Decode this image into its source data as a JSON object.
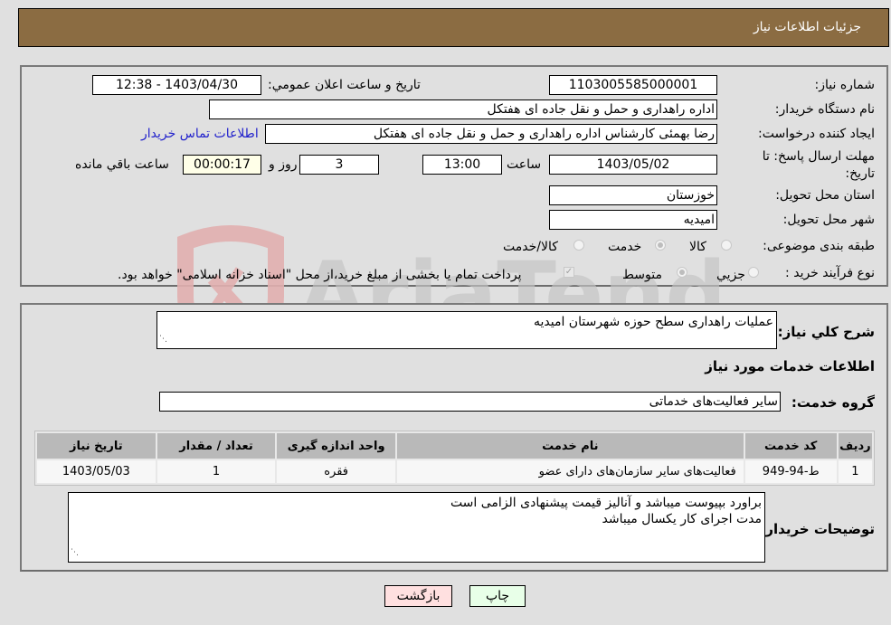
{
  "header": {
    "title": "جزئیات اطلاعات نیاز"
  },
  "form": {
    "need_number": {
      "label": "شماره نیاز:",
      "value": "1103005585000001"
    },
    "announce_datetime": {
      "label": "تاریخ و ساعت اعلان عمومي:",
      "value": "1403/04/30 - 12:38"
    },
    "buyer_org": {
      "label": "نام دستگاه خریدار:",
      "value": "اداره راهداری و حمل و نقل جاده ای هفتکل"
    },
    "requester": {
      "label": "ایجاد کننده درخواست:",
      "value": "رضا بهمئی کارشناس اداره راهداری و حمل و نقل جاده ای هفتکل"
    },
    "contact_link": "اطلاعات تماس خریدار",
    "deadline": {
      "label": "مهلت ارسال پاسخ: تا تاریخ:",
      "date": "1403/05/02",
      "time_label": "ساعت",
      "time": "13:00",
      "days": "3",
      "days_label": "روز و",
      "remaining": "00:00:17",
      "remaining_label": "ساعت باقي مانده"
    },
    "province": {
      "label": "استان محل تحویل:",
      "value": "خوزستان"
    },
    "city": {
      "label": "شهر محل تحویل:",
      "value": "امیدیه"
    },
    "category": {
      "label": "طبقه بندی موضوعی:",
      "options": [
        "کالا",
        "خدمت",
        "کالا/خدمت"
      ],
      "selected": "خدمت"
    },
    "purchase_type": {
      "label": "نوع فرآیند خرید :",
      "options": [
        "جزيي",
        "متوسط"
      ],
      "selected": "متوسط",
      "treasury_checkbox_label": "پرداخت تمام یا بخشی از مبلغ خرید،از محل \"اسناد خزانه اسلامی\" خواهد بود.",
      "treasury_checked": true
    }
  },
  "details": {
    "description_label": "شرح کلي نیاز:",
    "description": "عملیات راهداری سطح حوزه شهرستان امیدیه",
    "services_heading": "اطلاعات خدمات مورد نیاز",
    "service_group_label": "گروه خدمت:",
    "service_group": "سایر فعالیت‌های خدماتی",
    "table": {
      "headers": [
        "ردیف",
        "کد خدمت",
        "نام خدمت",
        "واحد اندازه گیری",
        "تعداد / مقدار",
        "تاریخ نیاز"
      ],
      "rows": [
        [
          "1",
          "ط-94-949",
          "فعالیت‌های سایر سازمان‌های دارای عضو",
          "فقره",
          "1",
          "1403/05/03"
        ]
      ]
    },
    "buyer_notes_label": "توضیحات خریدار:",
    "buyer_notes_lines": [
      "براورد بپیوست میباشد و آنالیز قیمت پیشنهادی الزامی است",
      "مدت اجرای کار یکسال میباشد"
    ]
  },
  "buttons": {
    "print": "چاپ",
    "back": "بازگشت"
  },
  "watermark": {
    "text": "AriaTender.neT"
  },
  "colors": {
    "header_bg": "#8b6c42",
    "link": "#2222cc",
    "back_btn": "#ffe0e0",
    "print_btn": "#e8ffe8"
  }
}
